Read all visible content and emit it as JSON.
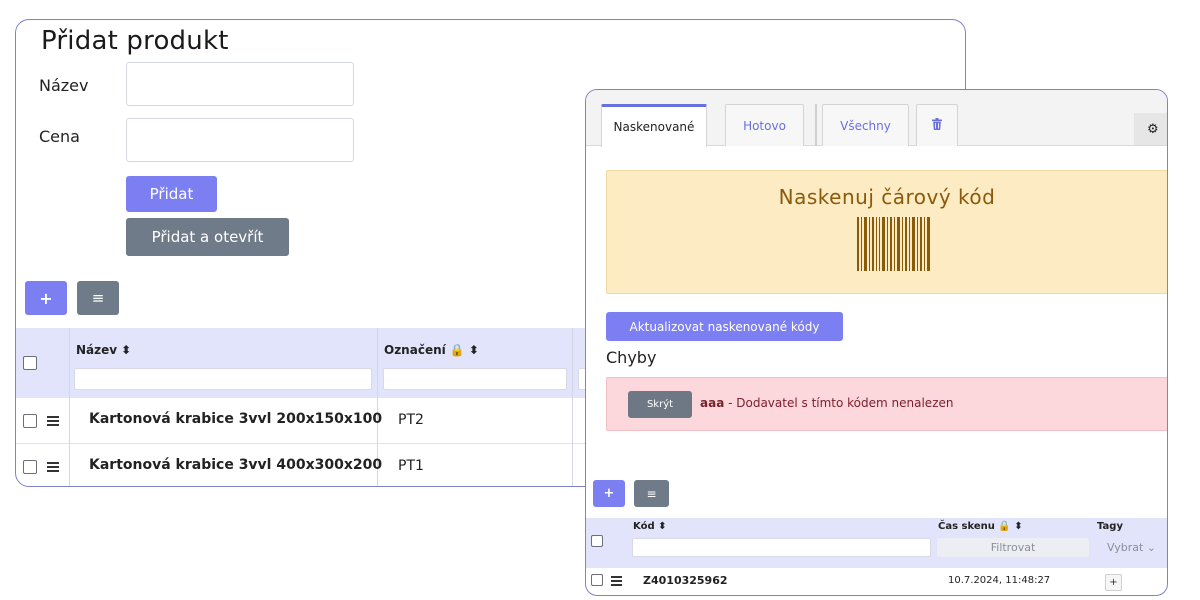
{
  "product_form": {
    "title": "Přidat produkt",
    "name_label": "Název",
    "price_label": "Cena",
    "name_value": "",
    "price_value": "",
    "add_button": "Přidat",
    "add_open_button": "Přidat a otevřít"
  },
  "products_table": {
    "add_icon": "+",
    "menu_icon": "≡",
    "columns": [
      {
        "label": "Název",
        "sort": "⬍"
      },
      {
        "label": "Označení 🔒",
        "sort": "⬍"
      }
    ],
    "rows": [
      {
        "name": "Kartonová krabice 3vvl 200x150x100",
        "code": "PT2"
      },
      {
        "name": "Kartonová krabice 3vvl 400x300x200",
        "code": "PT1"
      }
    ]
  },
  "scanner": {
    "tabs": [
      "Naskenované",
      "Hotovo",
      "Všechny",
      "🗑"
    ],
    "active_tab": "Naskenované",
    "settings_icon": "⚙",
    "scan_prompt": "Naskenuj čárový kód",
    "update_button": "Aktualizovat naskenované kódy",
    "errors_title": "Chyby",
    "error": {
      "hide_button": "Skrýt",
      "code": "aaa",
      "message": " - Dodavatel s tímto kódem nenalezen"
    },
    "table": {
      "add_icon": "+",
      "menu_icon": "≡",
      "columns": [
        {
          "label": "Kód ⬍"
        },
        {
          "label": "Čas skenu 🔒 ⬍",
          "filter_placeholder": "Filtrovat"
        },
        {
          "label": "Tagy",
          "filter_placeholder": "Vybrat ⌄"
        }
      ],
      "rows": [
        {
          "code": "Z4010325962",
          "scan_time": "10.7.2024, 11:48:27",
          "tag_add": "+"
        }
      ]
    }
  },
  "colors": {
    "primary": "#7b7ff2",
    "secondary": "#6f7b88",
    "header_bg": "#e2e4fb",
    "scan_bg": "#fdebc3",
    "error_bg": "#fcd7dc"
  }
}
